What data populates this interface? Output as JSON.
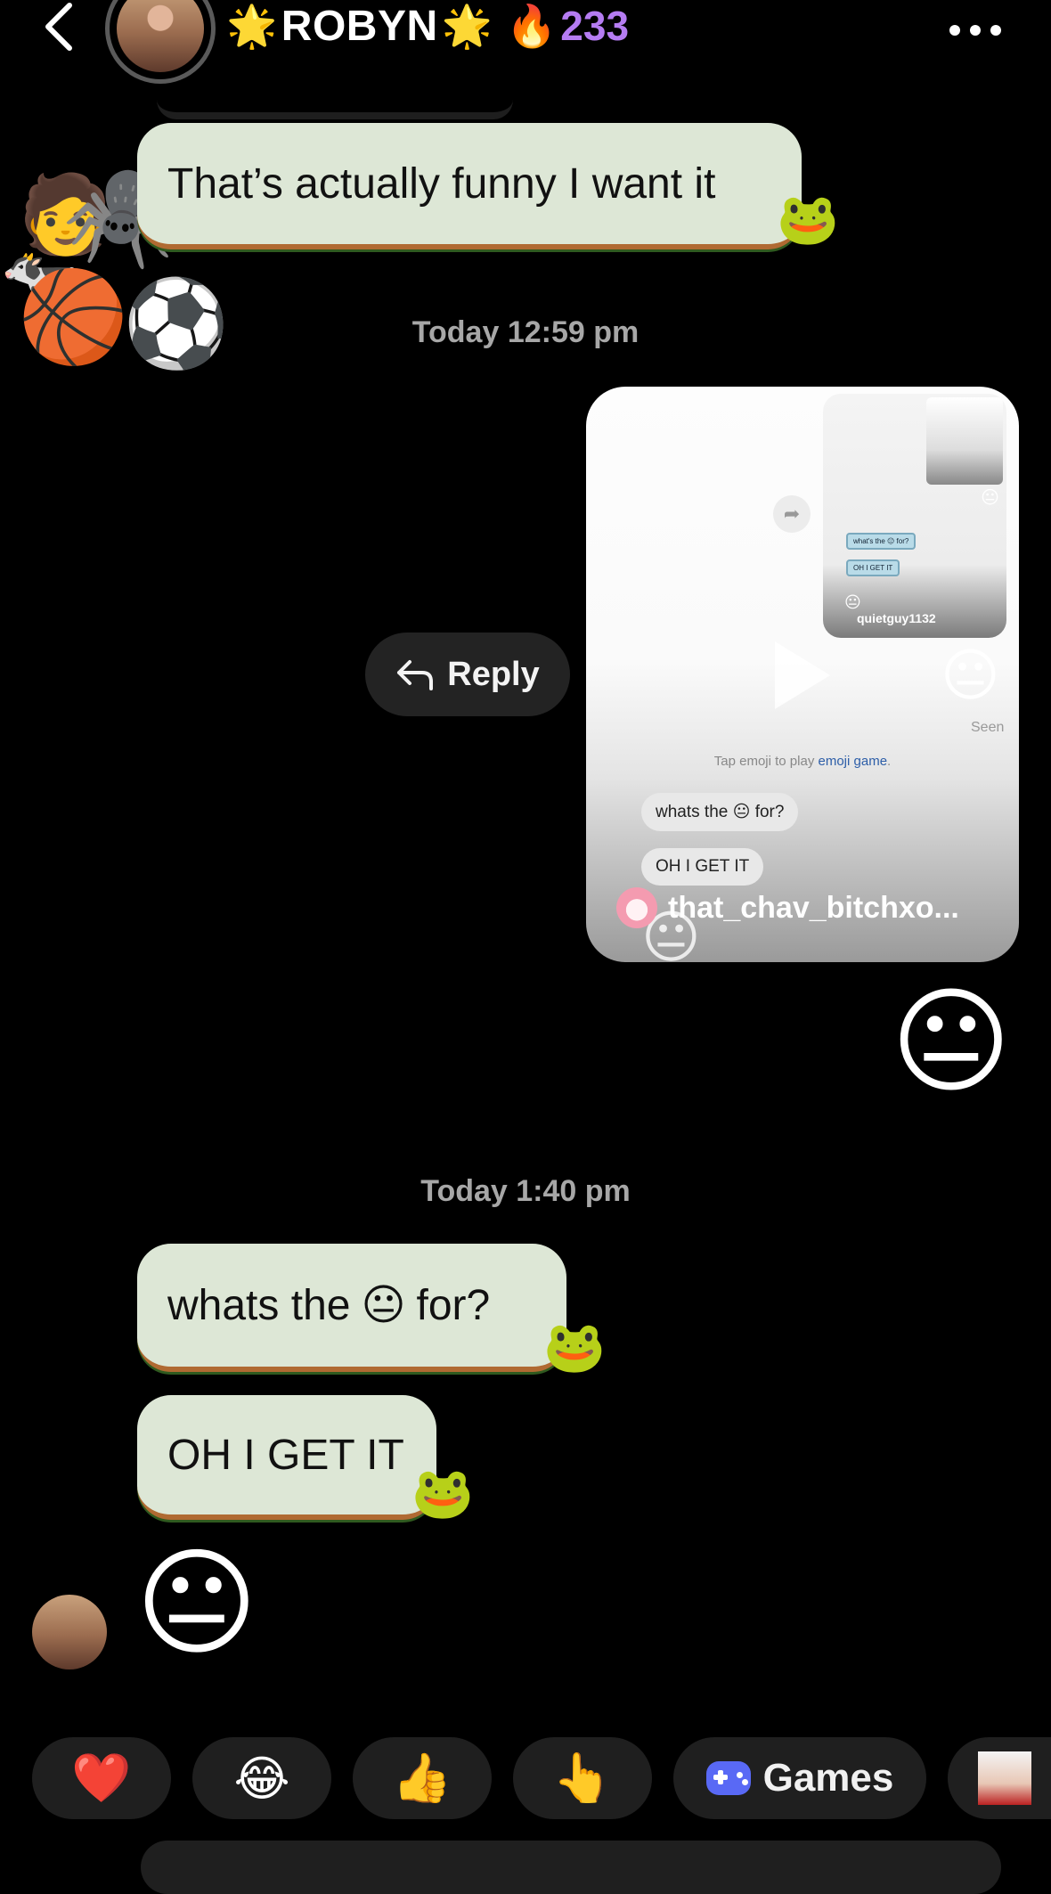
{
  "header": {
    "contact_name": "ROBYN",
    "streak_count": "233"
  },
  "messages": {
    "funny_text": "That’s actually funny I want it",
    "timestamp_1": "Today 12:59 pm",
    "timestamp_2": "Today 1:40 pm",
    "whats_the_prefix": "whats the",
    "whats_the_emoji": "😐",
    "whats_the_suffix": "for?",
    "oh_i_get_it": "OH I GET IT",
    "emoji_reply": "😐",
    "sent_emoji": "😐"
  },
  "reel": {
    "inner_user": "quietguy1132",
    "inner_bubble_1": "what's the 😐 for?",
    "inner_bubble_2": "OH I GET IT",
    "seen": "Seen",
    "hint_prefix": "Tap emoji to play",
    "hint_link": "emoji game",
    "hint_suffix": ".",
    "chat_line_1_prefix": "whats the",
    "chat_line_1_emoji": "😐",
    "chat_line_1_suffix": "for?",
    "chat_line_2": "OH I GET IT",
    "big_emoji": "😐",
    "author": "that_chav_bitchxo..."
  },
  "actions": {
    "reply_label": "Reply"
  },
  "quick_reactions": {
    "heart": "❤️",
    "laugh": "😂",
    "thumbs": "👍",
    "point": "👆",
    "games_label": "Games"
  },
  "colors": {
    "bubble_bg": "#dde7d6",
    "streak": "#b57cf2",
    "chip_bg": "#1f1f1f",
    "gamepad": "#5969f5"
  }
}
